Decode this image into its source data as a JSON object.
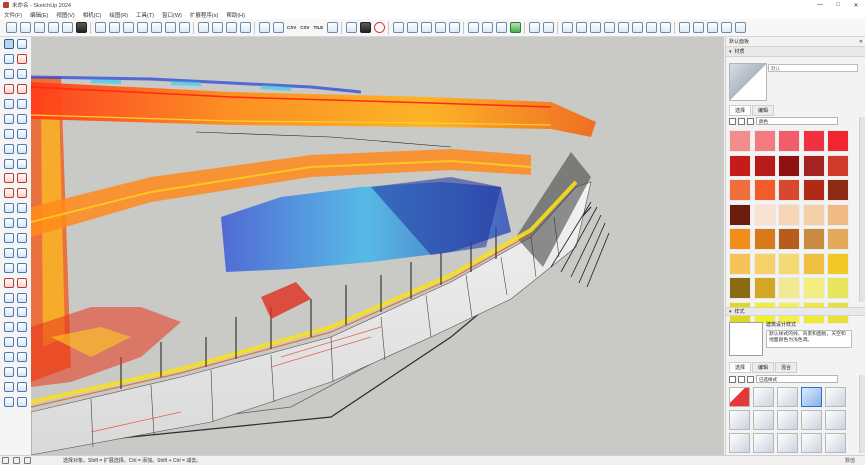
{
  "window": {
    "title": "未命名 - SketchUp 2024",
    "minimize": "—",
    "maximize": "□",
    "close": "✕"
  },
  "menu": [
    "文件(F)",
    "编辑(E)",
    "视图(V)",
    "相机(C)",
    "绘图(R)",
    "工具(T)",
    "窗口(W)",
    "扩展程序(x)",
    "帮助(H)"
  ],
  "toolbar": {
    "csv_label_1": "CSV",
    "csv_label_2": "CSV",
    "tile_label": "TILE"
  },
  "right_panel": {
    "title": "默认面板",
    "materials_section": "材质",
    "material_name_placeholder": "默认",
    "tab_select": "选择",
    "tab_edit": "编辑",
    "category": "颜色",
    "styles_section": "样式",
    "style_name": "建筑设计样式",
    "style_description": "默认样式的线、背景和面板，天空和地面颜色为浅色调。",
    "style_tab_select": "选择",
    "style_tab_edit": "编辑",
    "style_tab_mix": "混合",
    "style_category": "已选样式"
  },
  "colors": {
    "swatches": [
      "#f58c8c",
      "#f47a82",
      "#f35c6a",
      "#f0313f",
      "#f0252f",
      "#c61b1b",
      "#b61a1a",
      "#8e1212",
      "#a52222",
      "#cf3a2a",
      "#f06d3c",
      "#f25c2a",
      "#d8482e",
      "#b02a16",
      "#8c2a14",
      "#6b1d0f",
      "#f9e2d2",
      "#f6d5b5",
      "#f4cfa8",
      "#efba85",
      "#f28c1a",
      "#d97a18",
      "#b85c1a",
      "#c98a42",
      "#e3a858",
      "#f6c25a",
      "#f6d16a",
      "#f5da73",
      "#f2c040",
      "#f0c828",
      "#8a6a10",
      "#d3a726",
      "#f1ea90",
      "#f4ef80",
      "#e8e65c",
      "#e0d820",
      "#f2f02a",
      "#f6f04a",
      "#f2ea30",
      "#eae038"
    ]
  },
  "status": {
    "text": "选择对象。Shift = 扩展选择。Ctrl = 添加。Shift + Ctrl = 减去。",
    "measure_label": "数值"
  }
}
